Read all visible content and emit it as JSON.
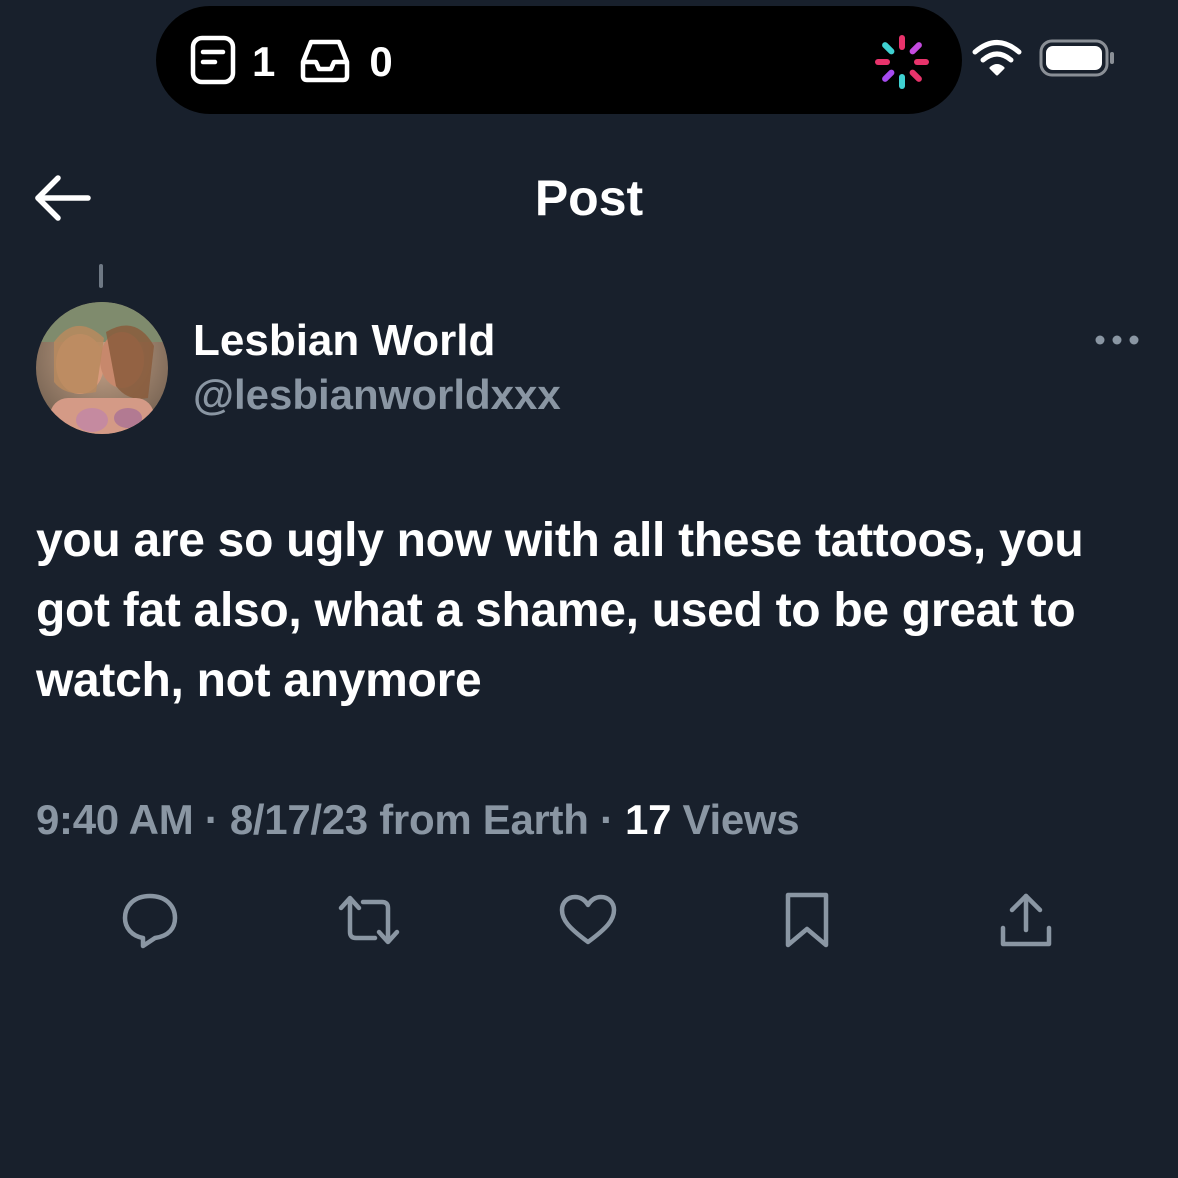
{
  "status_bar": {
    "notes_count": "1",
    "inbox_count": "0",
    "icons": [
      "notes-icon",
      "inbox-tray-icon",
      "activity-spinner-icon",
      "wifi-icon",
      "battery-icon"
    ]
  },
  "header": {
    "title": "Post",
    "back_icon": "back-arrow-icon"
  },
  "post": {
    "author": {
      "display_name": "Lesbian World",
      "handle": "@lesbianworldxxx"
    },
    "text": "you are so ugly now with all these tattoos, you got fat also, what a shame, used to be great to watch, not anymore",
    "meta": {
      "time": "9:40 AM",
      "separator": " · ",
      "date_source": "8/17/23 from Earth",
      "views_count": "17",
      "views_label": " Views"
    },
    "actions": [
      "reply-icon",
      "repost-icon",
      "like-icon",
      "bookmark-icon",
      "share-icon"
    ]
  },
  "colors": {
    "background": "#18202c",
    "text_primary": "#ffffff",
    "text_secondary": "#8a96a3",
    "icon": "#8a96a3"
  }
}
